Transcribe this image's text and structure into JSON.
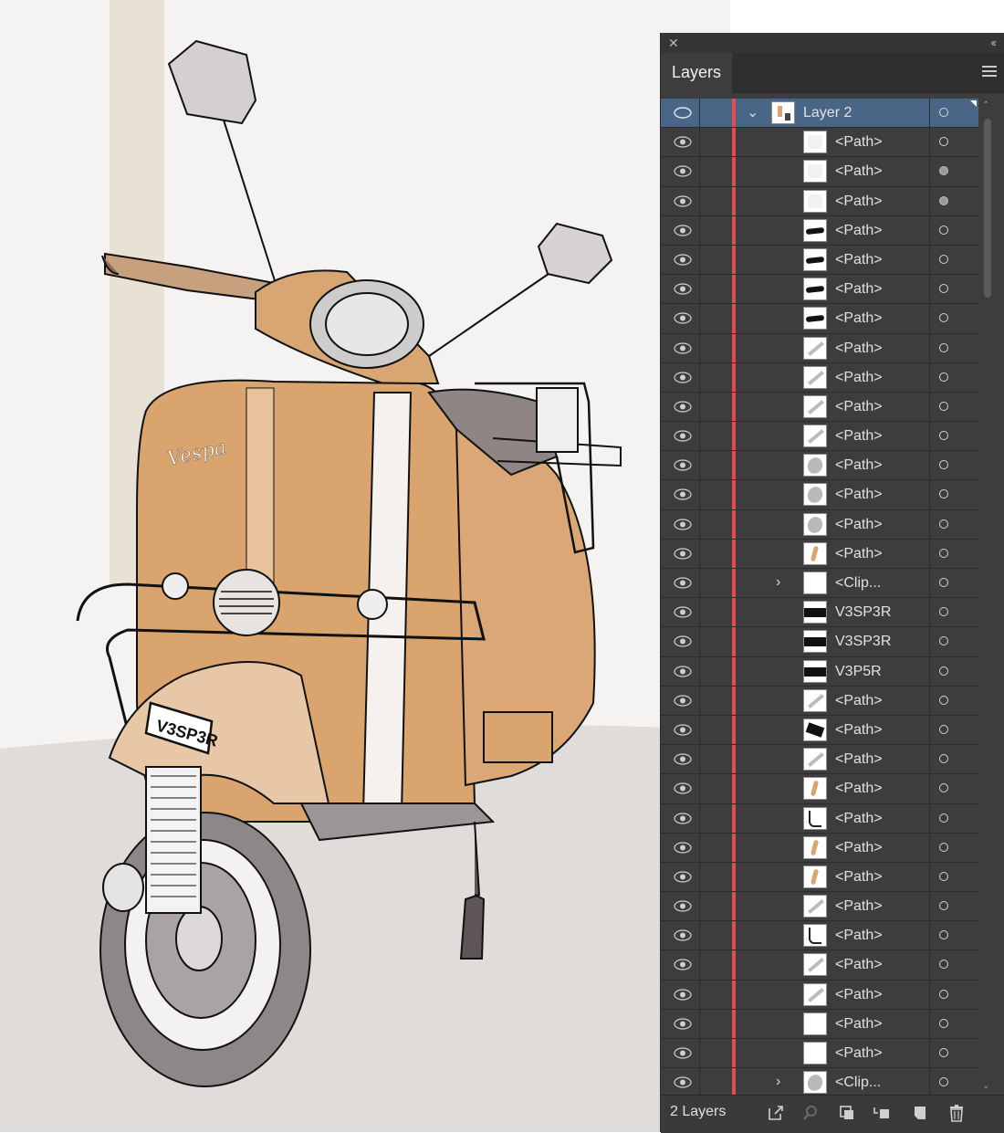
{
  "panel": {
    "title": "Layers",
    "footer_label": "2 Layers",
    "layer": {
      "name": "Layer 2",
      "expanded": true
    },
    "rows": [
      {
        "name": "<Path>",
        "thumb": "blank-light",
        "target": "empty",
        "disclosure": false
      },
      {
        "name": "<Path>",
        "thumb": "blank-light",
        "target": "filled",
        "disclosure": false
      },
      {
        "name": "<Path>",
        "thumb": "blank-light",
        "target": "filled",
        "disclosure": false
      },
      {
        "name": "<Path>",
        "thumb": "black-stroke",
        "target": "empty",
        "disclosure": false
      },
      {
        "name": "<Path>",
        "thumb": "black-stroke",
        "target": "empty",
        "disclosure": false
      },
      {
        "name": "<Path>",
        "thumb": "black-stroke",
        "target": "empty",
        "disclosure": false
      },
      {
        "name": "<Path>",
        "thumb": "black-stroke",
        "target": "empty",
        "disclosure": false
      },
      {
        "name": "<Path>",
        "thumb": "grey-diagonal",
        "target": "empty",
        "disclosure": false
      },
      {
        "name": "<Path>",
        "thumb": "grey-diagonal",
        "target": "empty",
        "disclosure": false
      },
      {
        "name": "<Path>",
        "thumb": "grey-diagonal",
        "target": "empty",
        "disclosure": false
      },
      {
        "name": "<Path>",
        "thumb": "grey-diagonal",
        "target": "empty",
        "disclosure": false
      },
      {
        "name": "<Path>",
        "thumb": "grey-blob",
        "target": "empty",
        "disclosure": false
      },
      {
        "name": "<Path>",
        "thumb": "grey-blob",
        "target": "empty",
        "disclosure": false
      },
      {
        "name": "<Path>",
        "thumb": "grey-blob",
        "target": "empty",
        "disclosure": false
      },
      {
        "name": "<Path>",
        "thumb": "orange-stroke",
        "target": "empty",
        "disclosure": false
      },
      {
        "name": "<Clip...",
        "thumb": "blank",
        "target": "empty",
        "disclosure": true
      },
      {
        "name": "V3SP3R",
        "thumb": "text-plate",
        "target": "empty",
        "disclosure": false
      },
      {
        "name": "V3SP3R",
        "thumb": "text-plate",
        "target": "empty",
        "disclosure": false
      },
      {
        "name": "V3P5R",
        "thumb": "text-plate",
        "target": "empty",
        "disclosure": false
      },
      {
        "name": "<Path>",
        "thumb": "grey-diagonal",
        "target": "empty",
        "disclosure": false
      },
      {
        "name": "<Path>",
        "thumb": "black-block",
        "target": "empty",
        "disclosure": false
      },
      {
        "name": "<Path>",
        "thumb": "grey-diagonal",
        "target": "empty",
        "disclosure": false
      },
      {
        "name": "<Path>",
        "thumb": "orange-stroke",
        "target": "empty",
        "disclosure": false
      },
      {
        "name": "<Path>",
        "thumb": "black-curve",
        "target": "empty",
        "disclosure": false
      },
      {
        "name": "<Path>",
        "thumb": "orange-stroke",
        "target": "empty",
        "disclosure": false
      },
      {
        "name": "<Path>",
        "thumb": "orange-stroke",
        "target": "empty",
        "disclosure": false
      },
      {
        "name": "<Path>",
        "thumb": "grey-diagonal",
        "target": "empty",
        "disclosure": false
      },
      {
        "name": "<Path>",
        "thumb": "black-curve",
        "target": "empty",
        "disclosure": false
      },
      {
        "name": "<Path>",
        "thumb": "grey-diagonal",
        "target": "empty",
        "disclosure": false
      },
      {
        "name": "<Path>",
        "thumb": "grey-diagonal",
        "target": "empty",
        "disclosure": false
      },
      {
        "name": "<Path>",
        "thumb": "blank",
        "target": "empty",
        "disclosure": false
      },
      {
        "name": "<Path>",
        "thumb": "blank",
        "target": "empty",
        "disclosure": false
      },
      {
        "name": "<Clip...",
        "thumb": "grey-blob",
        "target": "empty",
        "disclosure": true
      }
    ],
    "footer_icons": [
      "export-icon",
      "search-icon",
      "clip-mask-icon",
      "new-sublayer-icon",
      "new-layer-icon",
      "trash-icon"
    ]
  },
  "artwork": {
    "plate_text": "V3SP3R",
    "badge_text": "Vespa"
  },
  "colors": {
    "panel_bg": "#3d3d3d",
    "selection": "#4a6687",
    "layer_color": "#e44d4d",
    "scooter_body": "#d9a46e"
  }
}
